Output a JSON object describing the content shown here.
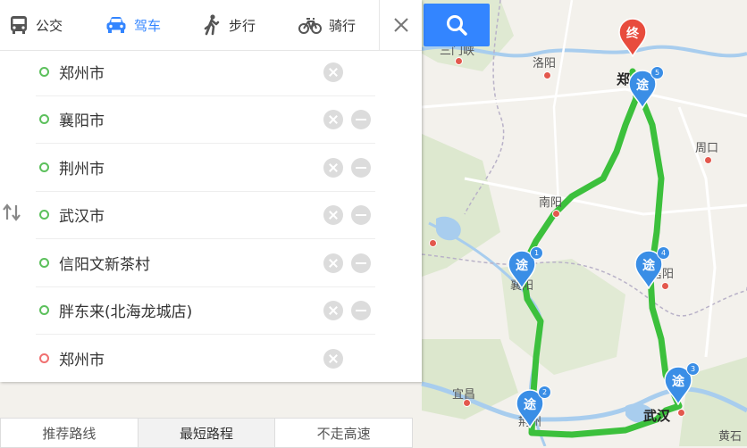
{
  "modes": [
    {
      "label": "公交",
      "icon": "bus-icon"
    },
    {
      "label": "驾车",
      "icon": "car-icon"
    },
    {
      "label": "步行",
      "icon": "walk-icon"
    },
    {
      "label": "骑行",
      "icon": "bike-icon"
    }
  ],
  "active_mode": "驾车",
  "stops": [
    {
      "label": "郑州市",
      "type": "start"
    },
    {
      "label": "襄阳市",
      "type": "via"
    },
    {
      "label": "荆州市",
      "type": "via"
    },
    {
      "label": "武汉市",
      "type": "via"
    },
    {
      "label": "信阳文新茶村",
      "type": "via"
    },
    {
      "label": "胖东来(北海龙城店)",
      "type": "via"
    },
    {
      "label": "郑州市",
      "type": "end"
    }
  ],
  "route_tabs": [
    "推荐路线",
    "最短路程",
    "不走高速"
  ],
  "active_route_tab": "最短路程",
  "map": {
    "labels": {
      "sanmenxia": "三门峡",
      "luoyang": "洛阳",
      "zhengzhou": "郑",
      "zhoukou": "周口",
      "nanyang": "南阳",
      "xiangyang": "襄阳",
      "xinyang": "信阳",
      "yichang": "宜昌",
      "jingzhou": "荆州",
      "wuhan": "武汉",
      "huangshi": "黄石"
    },
    "end_marker": "终",
    "via_marker": "途",
    "via_numbers": [
      "1",
      "2",
      "3",
      "4",
      "5"
    ]
  },
  "colors": {
    "accent": "#3385ff",
    "route": "#3cc03c",
    "start_dot": "#5cc05c",
    "end_dot": "#f07070",
    "pin_blue": "#3a8ee6",
    "pin_red": "#e84c3d"
  }
}
